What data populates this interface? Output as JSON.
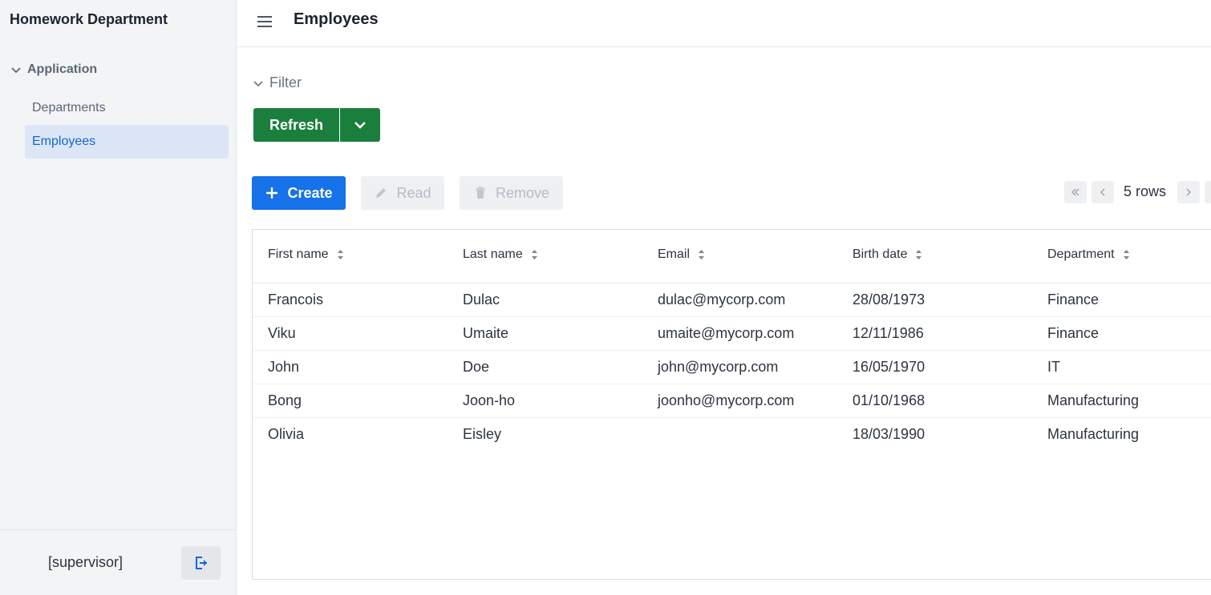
{
  "app": {
    "title": "Homework Department"
  },
  "sidebar": {
    "group_label": "Application",
    "items": [
      {
        "label": "Departments",
        "active": false
      },
      {
        "label": "Employees",
        "active": true
      }
    ],
    "user_label": "[supervisor]",
    "logout_icon": "logout-icon"
  },
  "header": {
    "title": "Employees",
    "menu_icon": "hamburger-icon"
  },
  "filter": {
    "label": "Filter",
    "icon": "chevron-down-icon"
  },
  "actions": {
    "refresh_label": "Refresh",
    "create_label": "Create",
    "read_label": "Read",
    "remove_label": "Remove"
  },
  "pagination": {
    "rows_label": "5 rows"
  },
  "table": {
    "columns": [
      "First name",
      "Last name",
      "Email",
      "Birth date",
      "Department"
    ],
    "rows": [
      [
        "Francois",
        "Dulac",
        "dulac@mycorp.com",
        "28/08/1973",
        "Finance"
      ],
      [
        "Viku",
        "Umaite",
        "umaite@mycorp.com",
        "12/11/1986",
        "Finance"
      ],
      [
        "John",
        "Doe",
        "john@mycorp.com",
        "16/05/1970",
        "IT"
      ],
      [
        "Bong",
        "Joon-ho",
        "joonho@mycorp.com",
        "01/10/1968",
        "Manufacturing"
      ],
      [
        "Olivia",
        "Eisley",
        "",
        "18/03/1990",
        "Manufacturing"
      ]
    ]
  },
  "colors": {
    "accent_blue": "#1572e8",
    "refresh_green": "#1a7f3c",
    "active_nav_bg": "#dde6f6",
    "active_nav_text": "#1566d6"
  }
}
